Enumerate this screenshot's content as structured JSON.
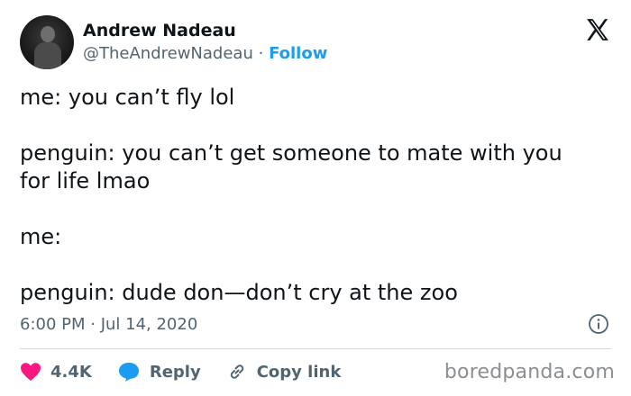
{
  "author": {
    "display_name": "Andrew Nadeau",
    "handle": "@TheAndrewNadeau",
    "separator": "·",
    "follow_label": "Follow"
  },
  "tweet": {
    "line1": "me: you can’t fly lol",
    "line2a": "penguin: you can’t get someone to mate with you",
    "line2b": "for life lmao",
    "line3": "me:",
    "line4": "penguin: dude don—don’t cry at the zoo",
    "timestamp": "6:00 PM · Jul 14, 2020"
  },
  "actions": {
    "likes": "4.4K",
    "reply_label": "Reply",
    "copy_label": "Copy link"
  },
  "watermark": "boredpanda.com",
  "icons": {
    "logo": "x-logo-icon",
    "info": "info-icon",
    "like": "heart-icon",
    "reply": "reply-bubble-icon",
    "copy": "link-icon"
  },
  "colors": {
    "accent": "#1d9bf0",
    "like": "#f91880",
    "text": "#0f1419",
    "secondary": "#536471",
    "divider": "#cfd9de"
  }
}
